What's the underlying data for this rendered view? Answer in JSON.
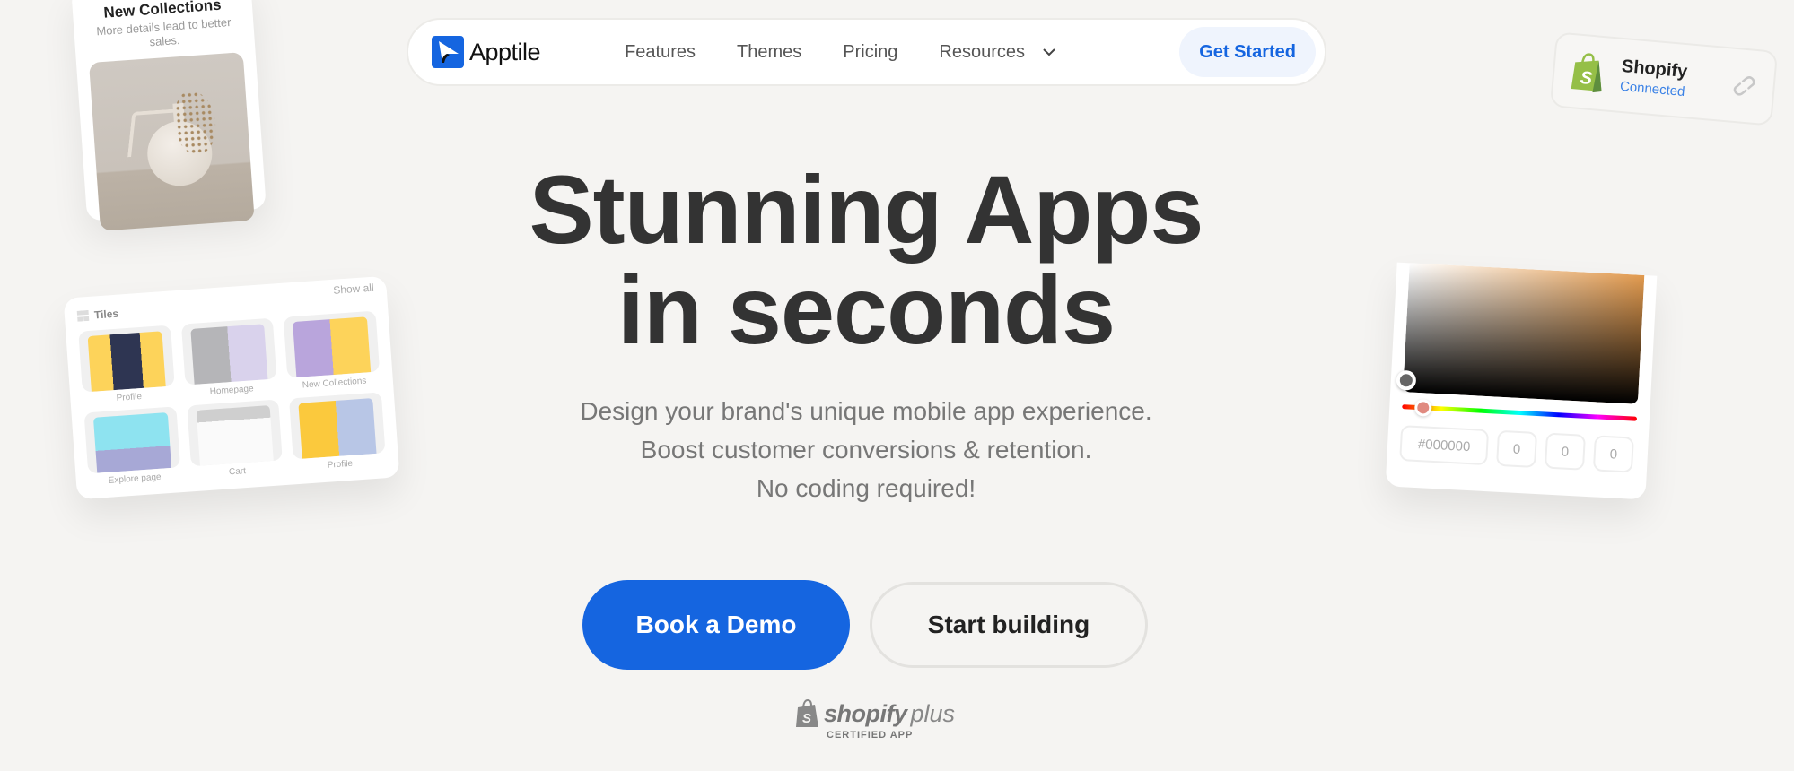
{
  "nav": {
    "brand": "Apptile",
    "links": [
      "Features",
      "Themes",
      "Pricing",
      "Resources"
    ],
    "cta": "Get Started"
  },
  "hero": {
    "title_line1": "Stunning Apps",
    "title_line2": "in seconds",
    "subtitle": [
      "Design your brand's unique mobile app experience.",
      "Boost customer conversions & retention.",
      "No coding required!"
    ],
    "primary_cta": "Book a Demo",
    "secondary_cta": "Start building"
  },
  "badge": {
    "brand": "shopify",
    "plus": "plus",
    "label": "CERTIFIED APP"
  },
  "collections_card": {
    "title": "New Collections",
    "subtitle": "More details lead to better sales."
  },
  "shopify_card": {
    "name": "Shopify",
    "status": "Connected"
  },
  "tiles_card": {
    "title": "Tiles",
    "show_all": "Show all",
    "tiles": [
      {
        "label": "Profile"
      },
      {
        "label": "Homepage"
      },
      {
        "label": "New Collections"
      },
      {
        "label": "Explore page"
      },
      {
        "label": "Cart"
      },
      {
        "label": "Profile"
      }
    ]
  },
  "color_picker": {
    "hex": "#000000",
    "r": "0",
    "g": "0",
    "b": "0"
  },
  "colors": {
    "accent": "#1565e0",
    "background": "#f5f4f2",
    "heading": "#333333",
    "shopify_green": "#95bf47"
  }
}
